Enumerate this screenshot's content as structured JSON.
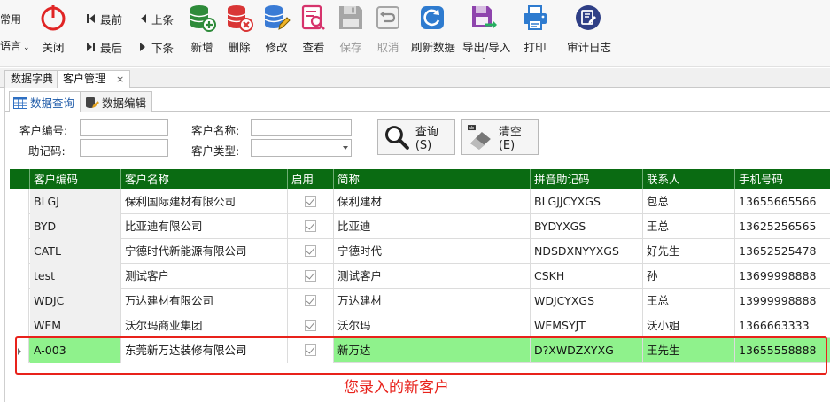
{
  "toolbar": {
    "partial_top": "常用",
    "partial_bottom": "语言",
    "close": "关闭",
    "first": "最前",
    "prev": "上条",
    "last": "最后",
    "next": "下条",
    "add": "新增",
    "delete": "删除",
    "edit": "修改",
    "view": "查看",
    "save": "保存",
    "cancel": "取消",
    "refresh": "刷新数据",
    "export_import": "导出/导入",
    "print": "打印",
    "audit_log": "审计日志"
  },
  "doc_tabs": {
    "dictionary": "数据字典",
    "customer_mgmt": "客户管理",
    "close_glyph": "×"
  },
  "sub_tabs": {
    "query": "数据查询",
    "edit": "数据编辑"
  },
  "search": {
    "customer_code_label": "客户编号:",
    "customer_name_label": "客户名称:",
    "mnemonic_label": "助记码:",
    "customer_type_label": "客户类型:",
    "customer_code_value": "",
    "customer_name_value": "",
    "mnemonic_value": "",
    "customer_type_value": "",
    "query_button": "查询(S)",
    "clear_button": "清空(E)"
  },
  "grid": {
    "columns": [
      "客户编码",
      "客户名称",
      "启用",
      "简称",
      "拼音助记码",
      "联系人",
      "手机号码"
    ],
    "rows": [
      {
        "code": "BLGJ",
        "name": "保利国际建材有限公司",
        "enabled": true,
        "short": "保利建材",
        "pinyin": "BLGJJCYXGS",
        "contact": "包总",
        "phone": "13655665566"
      },
      {
        "code": "BYD",
        "name": "比亚迪有限公司",
        "enabled": true,
        "short": "比亚迪",
        "pinyin": "BYDYXGS",
        "contact": "王总",
        "phone": "13625256565"
      },
      {
        "code": "CATL",
        "name": "宁德时代新能源有限公司",
        "enabled": true,
        "short": "宁德时代",
        "pinyin": "NDSDXNYYXGS",
        "contact": "好先生",
        "phone": "13652525478"
      },
      {
        "code": "test",
        "name": "测试客户",
        "enabled": true,
        "short": "测试客户",
        "pinyin": "CSKH",
        "contact": "孙",
        "phone": "13699998888"
      },
      {
        "code": "WDJC",
        "name": "万达建材有限公司",
        "enabled": true,
        "short": "万达建材",
        "pinyin": "WDJCYXGS",
        "contact": "王总",
        "phone": "13999998888"
      },
      {
        "code": "WEM",
        "name": "沃尔玛商业集团",
        "enabled": true,
        "short": "沃尔玛",
        "pinyin": "WEMSYJT",
        "contact": "沃小姐",
        "phone": "1366663333"
      },
      {
        "code": "A-003",
        "name": "东莞新万达装修有限公司",
        "enabled": true,
        "short": "新万达",
        "pinyin": "D?XWDZXYXG",
        "contact": "王先生",
        "phone": "13655558888"
      }
    ]
  },
  "annotation": "您录入的新客户",
  "colors": {
    "header_green": "#0a6b12",
    "selected_row": "#8ff28c",
    "annotation_red": "#e8221b"
  }
}
